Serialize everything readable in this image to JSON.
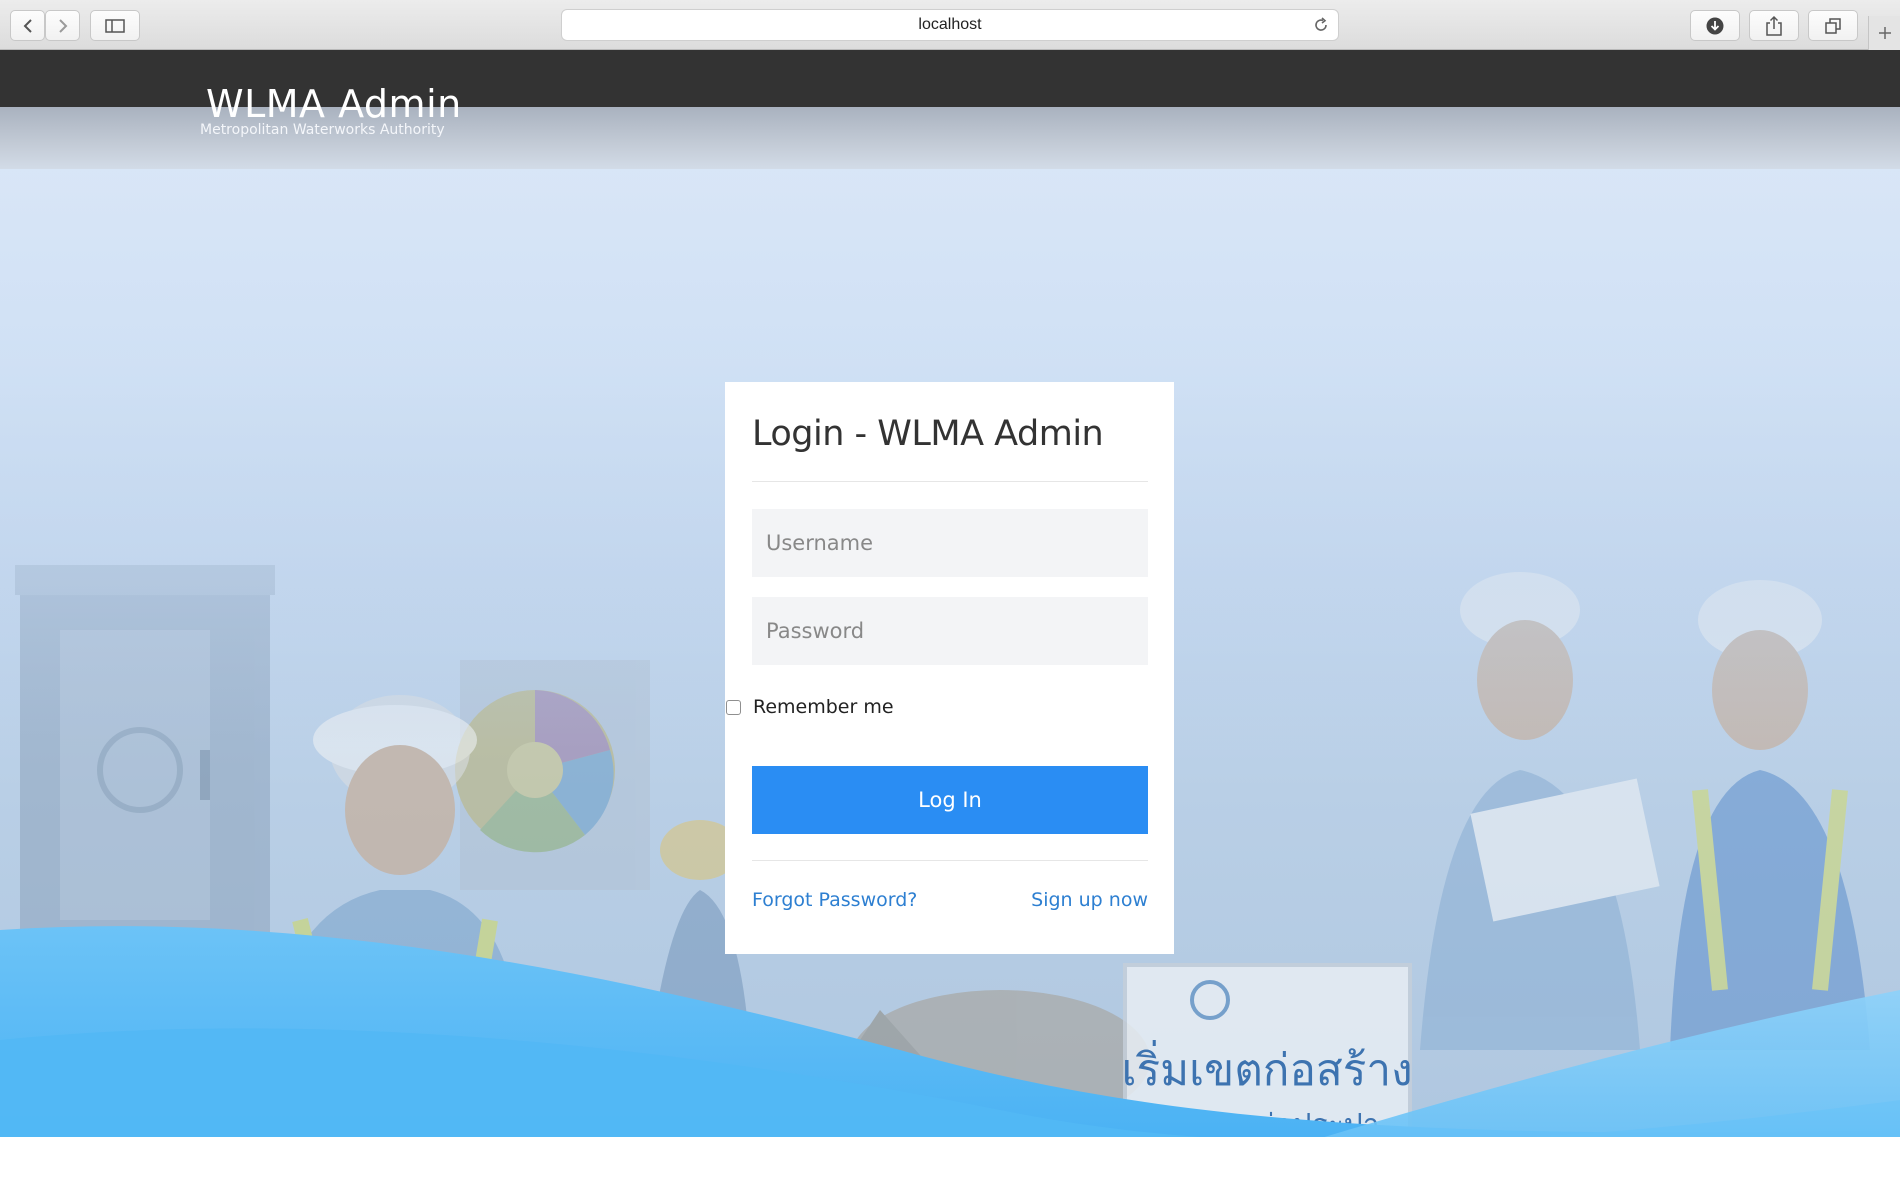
{
  "browser": {
    "url": "localhost"
  },
  "header": {
    "title": "WLMA Admin",
    "subtitle": "Metropolitan Waterworks Authority"
  },
  "login": {
    "title": "Login - WLMA Admin",
    "username_placeholder": "Username",
    "password_placeholder": "Password",
    "remember_label": "Remember me",
    "login_button": "Log In",
    "forgot_link": "Forgot Password?",
    "signup_link": "Sign up now"
  },
  "background": {
    "sign_line1": "เริ่มเขตก่อสร้าง",
    "sign_line2": "งานวางท่อประปา"
  },
  "colors": {
    "topbar": "#333333",
    "button": "#2a8df3",
    "link": "#2d7fd1",
    "wave": "#4fb4f5"
  }
}
